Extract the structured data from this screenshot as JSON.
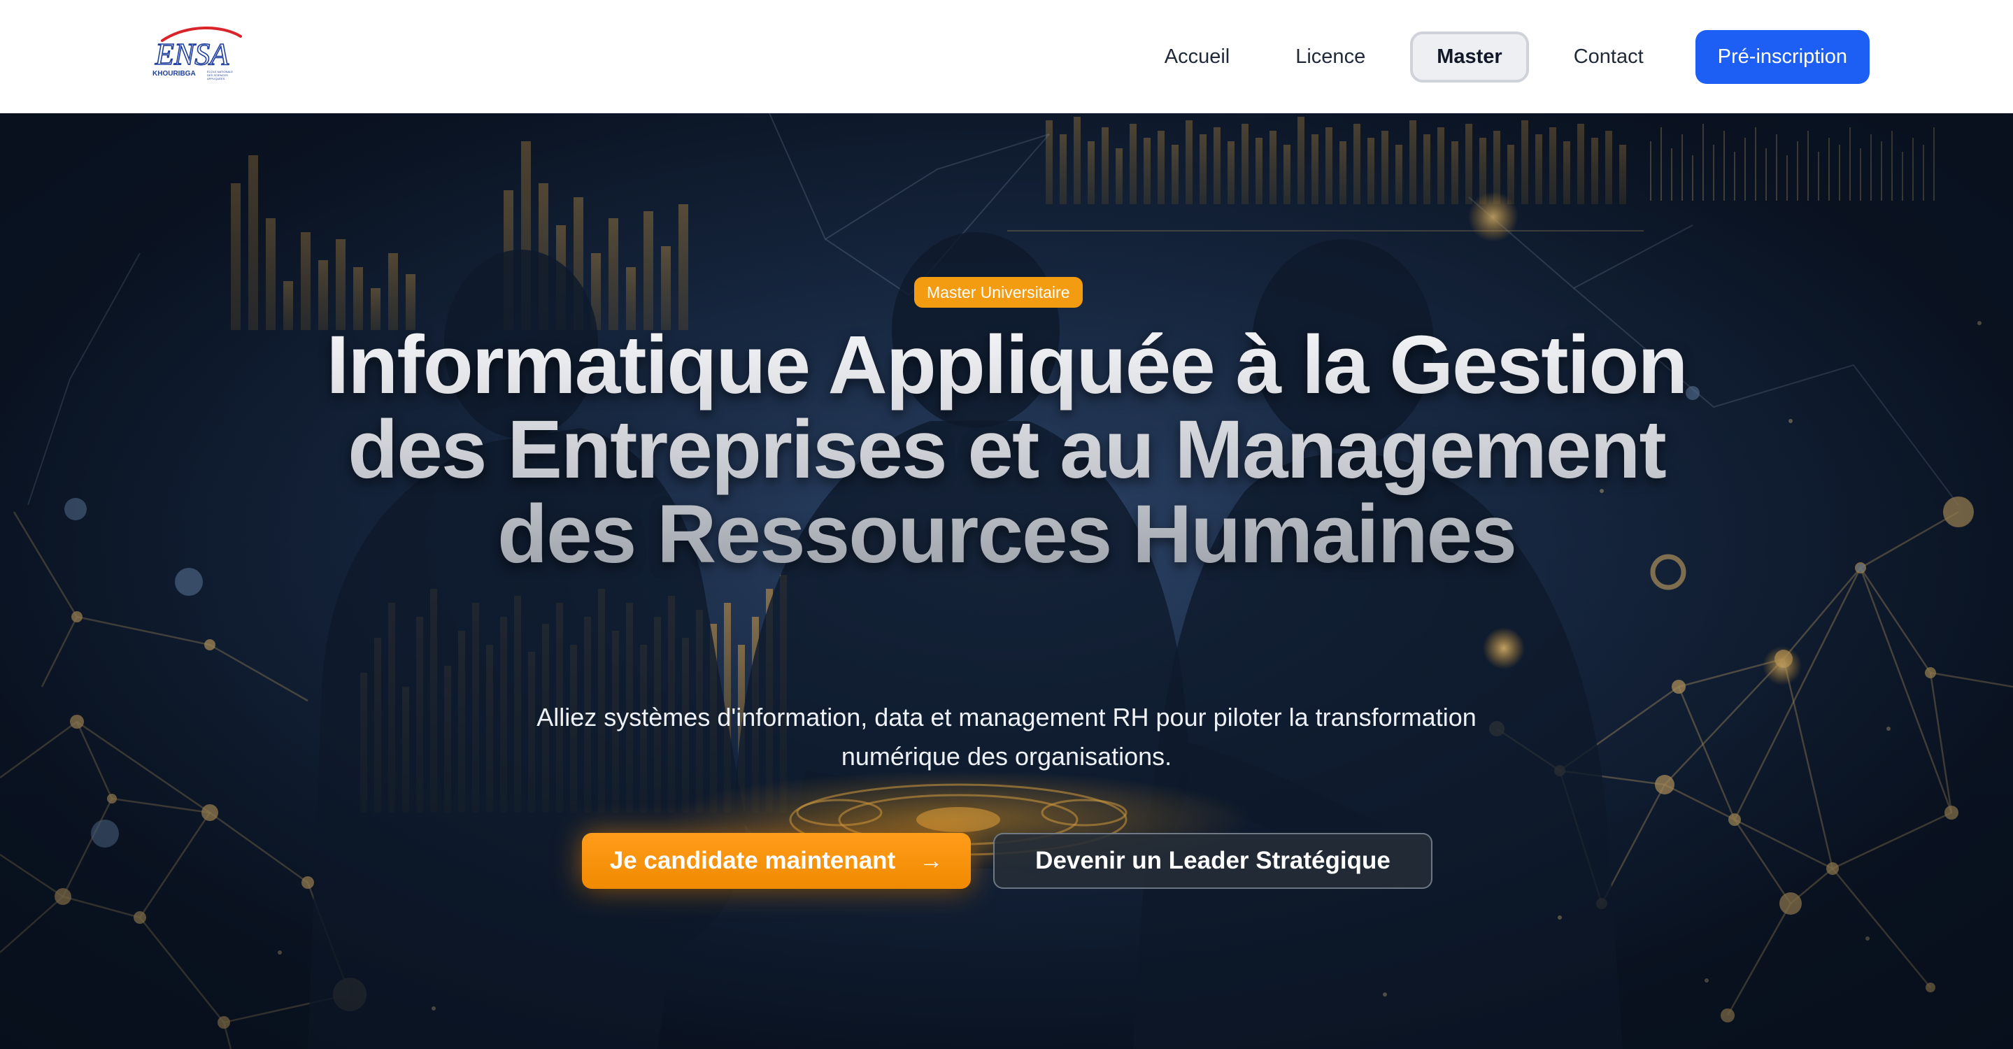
{
  "brand": {
    "logo_text": "ENSA",
    "logo_subtext": "KHOURIBGA",
    "logo_tagline": "ÉCOLE NATIONALE DES SCIENCES APPLIQUÉES",
    "colors": {
      "primary_blue": "#1d5ef5",
      "accent_orange": "#f39c12",
      "logo_red": "#d9252a",
      "logo_blue": "#1f3f9e"
    }
  },
  "nav": {
    "items": [
      {
        "label": "Accueil",
        "active": false
      },
      {
        "label": "Licence",
        "active": false
      },
      {
        "label": "Master",
        "active": true
      },
      {
        "label": "Contact",
        "active": false
      }
    ],
    "cta_label": "Pré-inscription"
  },
  "hero": {
    "badge": "Master Universitaire",
    "title": "Informatique Appliquée à la Gestion des Entreprises et au Management des Ressources Humaines",
    "subtitle": "Alliez systèmes d'information, data et management RH pour piloter la transformation numérique des organisations.",
    "primary_button": {
      "label": "Je candidate maintenant",
      "icon": "arrow-right-icon"
    },
    "secondary_button": {
      "label": "Devenir un Leader Stratégique"
    }
  }
}
